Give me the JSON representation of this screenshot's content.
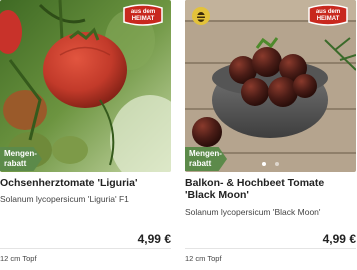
{
  "products": [
    {
      "name": "Ochsenherztomate 'Liguria'",
      "latin": "Solanum lycopersicum 'Liguria' F1",
      "price": "4,99 €",
      "pot": "12 cm Topf",
      "badge_line1": "Mengen-",
      "badge_line2": "rabatt",
      "seal_line1": "aus dem",
      "seal_line2": "HEIMAT",
      "image_subject": "tomato-plant-image"
    },
    {
      "name": "Balkon- & Hochbeet Tomate 'Black Moon'",
      "latin": "Solanum lycopersicum 'Black Moon'",
      "price": "4,99 €",
      "pot": "12 cm Topf",
      "badge_line1": "Mengen-",
      "badge_line2": "rabatt",
      "seal_line1": "aus dem",
      "seal_line2": "HEIMAT",
      "image_subject": "black-tomatoes-bowl-image"
    }
  ],
  "colors": {
    "badge_green": "#5c8a4a",
    "seal_red": "#c8281e",
    "tomato_red": "#c23a2a",
    "black_tomato": "#4a1c16"
  }
}
